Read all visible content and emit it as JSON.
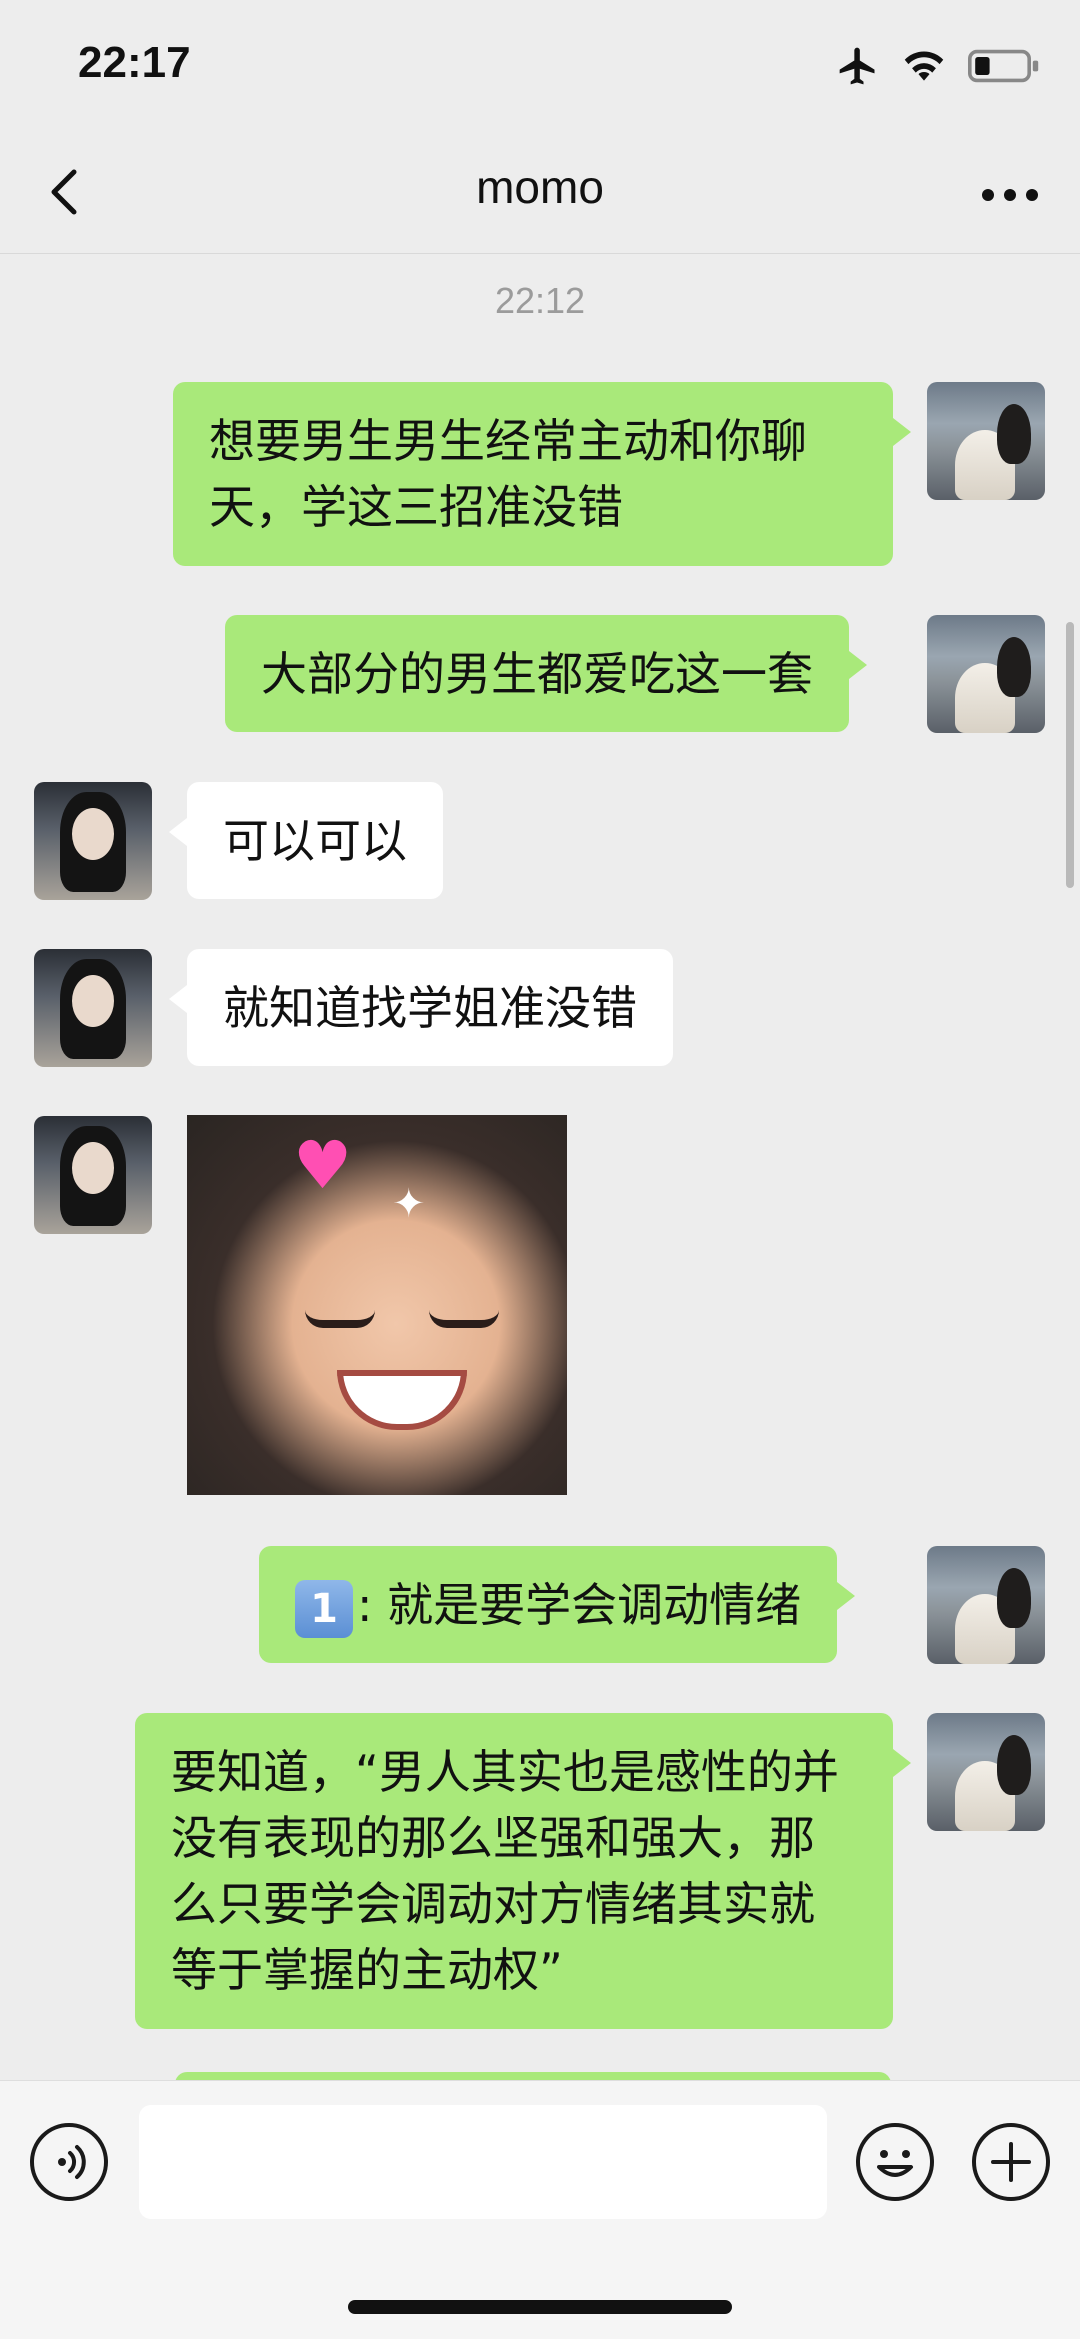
{
  "status_bar": {
    "time": "22:17"
  },
  "nav": {
    "title": "momo"
  },
  "timestamp": "22:12",
  "messages": [
    {
      "from": "me",
      "text": "想要男生男生经常主动和你聊天，学这三招准没错"
    },
    {
      "from": "me",
      "text": "大部分的男生都爱吃这一套"
    },
    {
      "from": "other",
      "text": "可以可以"
    },
    {
      "from": "other",
      "text": "就知道找学姐准没错"
    },
    {
      "from": "other",
      "type": "sticker",
      "sticker": "smiling-girl-heart-sticker"
    },
    {
      "from": "me",
      "badge": "1",
      "text": ": 就是要学会调动情绪"
    },
    {
      "from": "me",
      "text": "要知道，“男人其实也是感性的并没有表现的那么坚强和强大，那么只要学会调动对方情绪其实就等于掌握的主动权”"
    }
  ],
  "input": {
    "value": "",
    "placeholder": ""
  },
  "colors": {
    "background": "#ededed",
    "my_bubble": "#a9e97a",
    "their_bubble": "#ffffff",
    "timestamp": "#9b9b9b"
  }
}
